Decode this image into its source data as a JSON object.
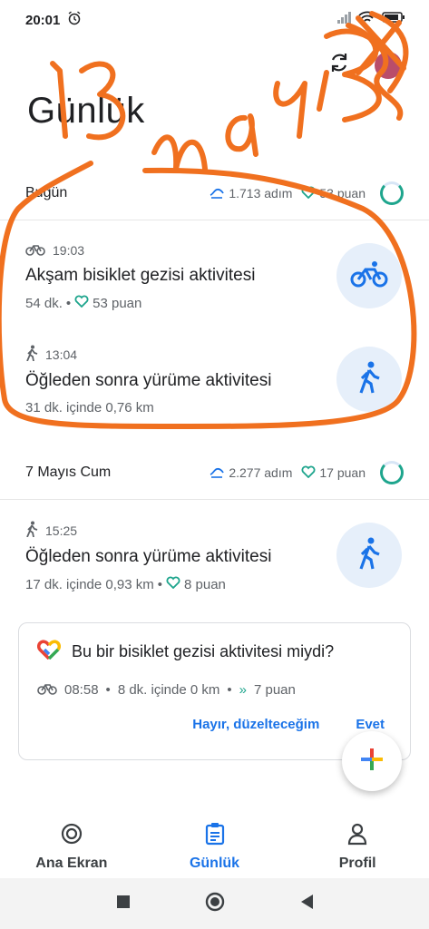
{
  "status": {
    "time": "20:01"
  },
  "page": {
    "title": "Günlük"
  },
  "days": [
    {
      "label": "Bugün",
      "steps": "1.713 adım",
      "points": "53 puan"
    },
    {
      "label": "7 Mayıs Cum",
      "steps": "2.277 adım",
      "points": "17 puan"
    }
  ],
  "activities": [
    {
      "time": "19:03",
      "title": "Akşam bisiklet gezisi aktivitesi",
      "duration": "54 dk.",
      "points": "53 puan",
      "type_icon": "bike-icon"
    },
    {
      "time": "13:04",
      "title": "Öğleden sonra yürüme aktivitesi",
      "summary": "31 dk. içinde 0,76 km",
      "type_icon": "walk-icon"
    },
    {
      "time": "15:25",
      "title": "Öğleden sonra yürüme aktivitesi",
      "summary": "17 dk. içinde 0,93 km",
      "points": "8 puan",
      "type_icon": "walk-icon"
    }
  ],
  "suggestion": {
    "question": "Bu bir bisiklet gezisi aktivitesi miydi?",
    "time": "08:58",
    "summary": "8 dk. içinde 0 km",
    "points": "7 puan",
    "decline_label": "Hayır, düzelteceğim",
    "confirm_label": "Evet"
  },
  "bottom_nav": [
    {
      "label": "Ana Ekran"
    },
    {
      "label": "Günlük"
    },
    {
      "label": "Profil"
    }
  ],
  "annotation": {
    "text": "13 mayıs",
    "color": "#f0701f"
  },
  "colors": {
    "accent": "#1a73e8",
    "heart_green": "#1ea58d",
    "icon_bg": "#e6effa"
  }
}
